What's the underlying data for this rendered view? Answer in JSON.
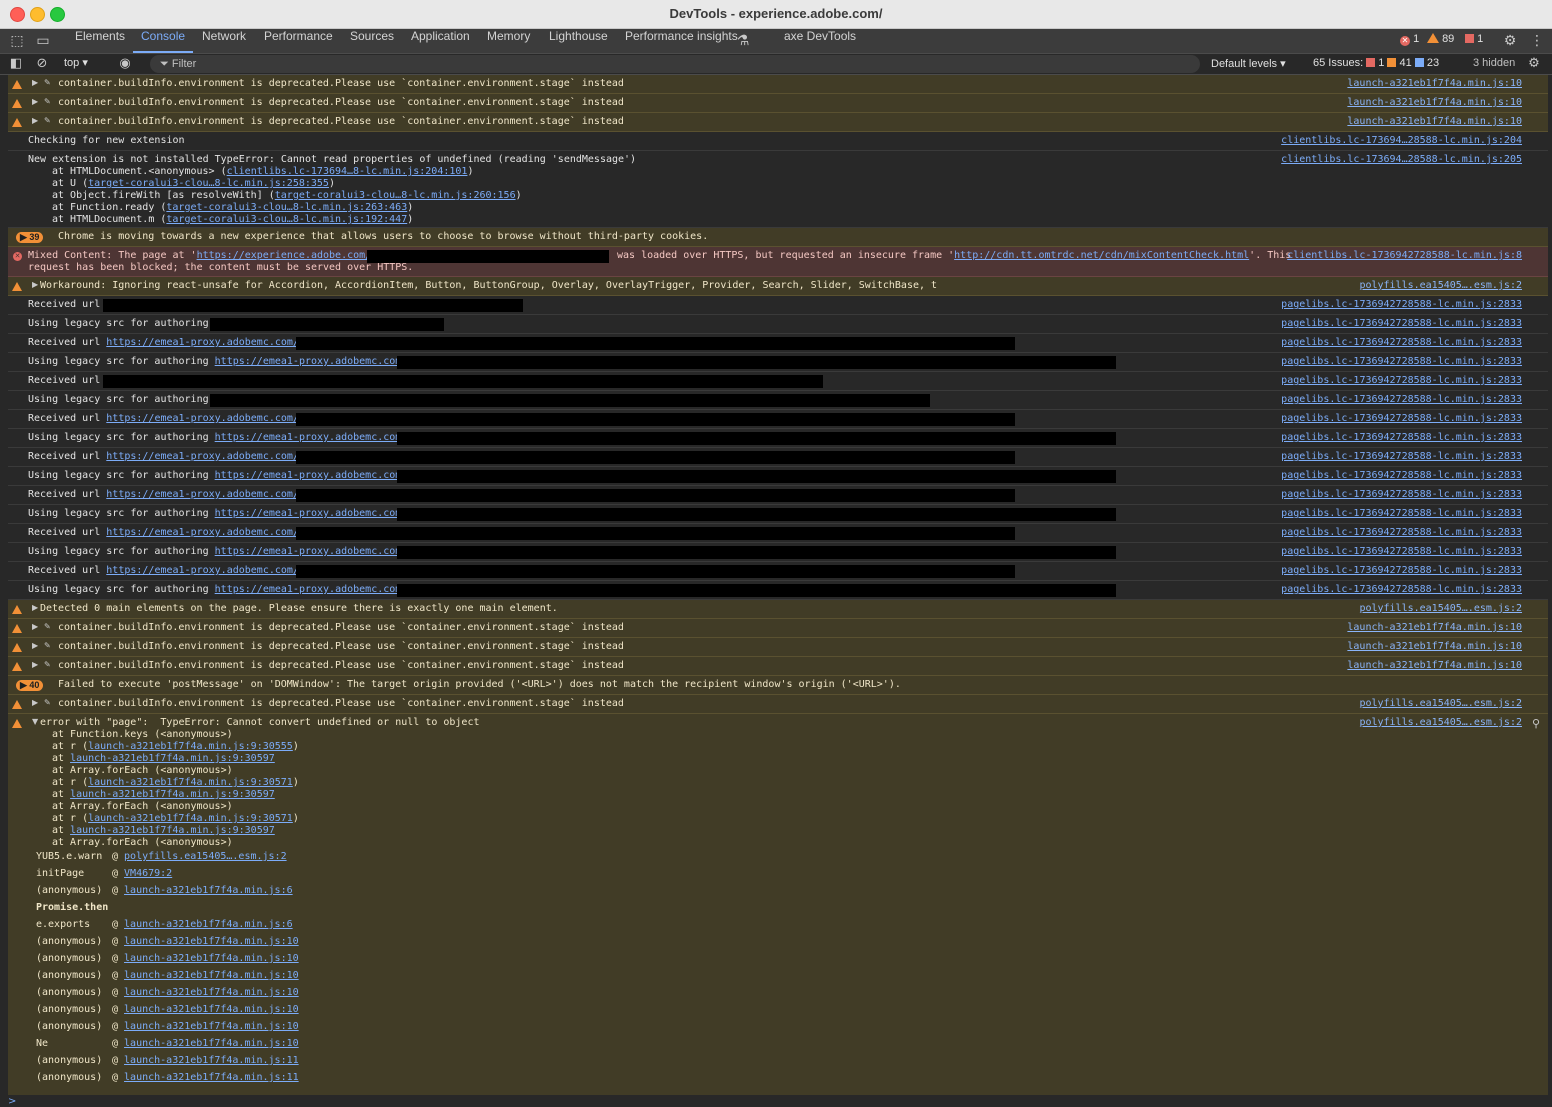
{
  "window": {
    "title": "DevTools - experience.adobe.com/"
  },
  "tabs": [
    "Elements",
    "Console",
    "Network",
    "Performance",
    "Sources",
    "Application",
    "Memory",
    "Lighthouse",
    "Performance insights",
    "axe DevTools"
  ],
  "tabbar_counts": {
    "errors": "1",
    "warnings": "89",
    "issues": "1"
  },
  "toolbar": {
    "context": "top",
    "filter_placeholder": "Filter",
    "levels": "Default levels",
    "issues_label": "65 Issues:",
    "issues_errors": "1",
    "issues_warnings": "41",
    "issues_info": "23",
    "hidden": "3 hidden"
  },
  "colors": {
    "accent": "#7cacf8",
    "warning_bg": "#413c26",
    "error_bg": "#4e3534",
    "warning_icon": "#f29037",
    "error_icon": "#e46962"
  },
  "rows": {
    "dep1": {
      "msg": "container.buildInfo.environment is deprecated.Please use `container.environment.stage` instead",
      "src": "launch-a321eb1f7f4a.min.js:10"
    },
    "dep2": {
      "msg": "container.buildInfo.environment is deprecated.Please use `container.environment.stage` instead",
      "src": "launch-a321eb1f7f4a.min.js:10"
    },
    "dep3": {
      "msg": "container.buildInfo.environment is deprecated.Please use `container.environment.stage` instead",
      "src": "launch-a321eb1f7f4a.min.js:10"
    },
    "check": {
      "msg": "Checking for new extension",
      "src": "clientlibs.lc-173694…28588-lc.min.js:204"
    },
    "newext": {
      "msg": "New extension is not installed TypeError: Cannot read properties of undefined (reading 'sendMessage')",
      "src": "clientlibs.lc-173694…28588-lc.min.js:205",
      "l1a": "at HTMLDocument.<anonymous> (",
      "l1b": "clientlibs.lc-173694…8-lc.min.js:204:101",
      "l1c": ")",
      "l2a": "at U (",
      "l2b": "target-coralui3-clou…8-lc.min.js:258:355",
      "l2c": ")",
      "l3a": "at Object.fireWith [as resolveWith] (",
      "l3b": "target-coralui3-clou…8-lc.min.js:260:156",
      "l3c": ")",
      "l4a": "at Function.ready (",
      "l4b": "target-coralui3-clou…8-lc.min.js:263:463",
      "l4c": ")",
      "l5a": "at HTMLDocument.m (",
      "l5b": "target-coralui3-clou…8-lc.min.js:192:447",
      "l5c": ")"
    },
    "chrome": {
      "count": "39",
      "msg": "Chrome is moving towards a new experience that allows users to choose to browse without third-party cookies."
    },
    "mixed": {
      "a": "Mixed Content: The page at '",
      "b": "https://experience.adobe.com/",
      "c": "was loaded over HTTPS, but requested an insecure frame '",
      "d": "http://cdn.tt.omtrdc.net/cdn/mixContentCheck.html",
      "e": "'. This",
      "line2": "request has been blocked; the content must be served over HTTPS.",
      "src": "clientlibs.lc-1736942728588-lc.min.js:8"
    },
    "workaround": {
      "msg": "Workaround: Ignoring react-unsafe for Accordion, AccordionItem, Button, ButtonGroup, Overlay, OverlayTrigger, Provider, Search, Slider, SwitchBase, t",
      "src": "polyfills.ea15405….esm.js:2"
    },
    "url_rows": [
      {
        "label": "Received url",
        "link": "",
        "src": "pagelibs.lc-1736942728588-lc.min.js:2833"
      },
      {
        "label": "Using legacy src for authoring",
        "link": "",
        "src": "pagelibs.lc-1736942728588-lc.min.js:2833"
      },
      {
        "label": "Received url",
        "link": "https://emea1-proxy.adobemc.com/",
        "src": "pagelibs.lc-1736942728588-lc.min.js:2833"
      },
      {
        "label": "Using legacy src for authoring",
        "link": "https://emea1-proxy.adobemc.com",
        "src": "pagelibs.lc-1736942728588-lc.min.js:2833"
      },
      {
        "label": "Received url",
        "link": "",
        "src": "pagelibs.lc-1736942728588-lc.min.js:2833"
      },
      {
        "label": "Using legacy src for authoring",
        "link": "",
        "src": "pagelibs.lc-1736942728588-lc.min.js:2833"
      },
      {
        "label": "Received url",
        "link": "https://emea1-proxy.adobemc.com/",
        "src": "pagelibs.lc-1736942728588-lc.min.js:2833"
      },
      {
        "label": "Using legacy src for authoring",
        "link": "https://emea1-proxy.adobemc.com",
        "src": "pagelibs.lc-1736942728588-lc.min.js:2833"
      },
      {
        "label": "Received url",
        "link": "https://emea1-proxy.adobemc.com/",
        "src": "pagelibs.lc-1736942728588-lc.min.js:2833"
      },
      {
        "label": "Using legacy src for authoring",
        "link": "https://emea1-proxy.adobemc.com",
        "src": "pagelibs.lc-1736942728588-lc.min.js:2833"
      },
      {
        "label": "Received url",
        "link": "https://emea1-proxy.adobemc.com/",
        "src": "pagelibs.lc-1736942728588-lc.min.js:2833"
      },
      {
        "label": "Using legacy src for authoring",
        "link": "https://emea1-proxy.adobemc.com",
        "src": "pagelibs.lc-1736942728588-lc.min.js:2833"
      },
      {
        "label": "Received url",
        "link": "https://emea1-proxy.adobemc.com/",
        "src": "pagelibs.lc-1736942728588-lc.min.js:2833"
      },
      {
        "label": "Using legacy src for authoring",
        "link": "https://emea1-proxy.adobemc.com",
        "src": "pagelibs.lc-1736942728588-lc.min.js:2833"
      },
      {
        "label": "Received url",
        "link": "https://emea1-proxy.adobemc.com/",
        "src": "pagelibs.lc-1736942728588-lc.min.js:2833"
      },
      {
        "label": "Using legacy src for authoring",
        "link": "https://emea1-proxy.adobemc.com",
        "src": "pagelibs.lc-1736942728588-lc.min.js:2833"
      }
    ],
    "detected": {
      "msg": "Detected 0 main elements on the page. Please ensure there is exactly one main element.",
      "src": "polyfills.ea15405….esm.js:2"
    },
    "dep4": {
      "msg": "container.buildInfo.environment is deprecated.Please use `container.environment.stage` instead",
      "src": "launch-a321eb1f7f4a.min.js:10"
    },
    "dep5": {
      "msg": "container.buildInfo.environment is deprecated.Please use `container.environment.stage` instead",
      "src": "launch-a321eb1f7f4a.min.js:10"
    },
    "dep6": {
      "msg": "container.buildInfo.environment is deprecated.Please use `container.environment.stage` instead",
      "src": "launch-a321eb1f7f4a.min.js:10"
    },
    "postmsg": {
      "count": "40",
      "msg": "Failed to execute 'postMessage' on 'DOMWindow': The target origin provided ('<URL>') does not match the recipient window's origin ('<URL>')."
    },
    "dep7": {
      "msg": "container.buildInfo.environment is deprecated.Please use `container.environment.stage` instead",
      "src": "polyfills.ea15405….esm.js:2"
    },
    "pageerr": {
      "msg": "error with \"page\":  TypeError: Cannot convert undefined or null to object",
      "src": "polyfills.ea15405….esm.js:2",
      "s1": "at Function.keys (<anonymous>)",
      "s2a": "at r (",
      "s2b": "launch-a321eb1f7f4a.min.js:9:30555",
      "s2c": ")",
      "s3a": "at ",
      "s3b": "launch-a321eb1f7f4a.min.js:9:30597",
      "s4": "at Array.forEach (<anonymous>)",
      "s5a": "at r (",
      "s5b": "launch-a321eb1f7f4a.min.js:9:30571",
      "s5c": ")",
      "s6a": "at ",
      "s6b": "launch-a321eb1f7f4a.min.js:9:30597",
      "s7": "at Array.forEach (<anonymous>)",
      "s8a": "at r (",
      "s8b": "launch-a321eb1f7f4a.min.js:9:30571",
      "s8c": ")",
      "s9a": "at ",
      "s9b": "launch-a321eb1f7f4a.min.js:9:30597",
      "s10": "at Array.forEach (<anonymous>)",
      "calls": [
        {
          "fn": "YUB5.e.warn",
          "at": "@",
          "src": "polyfills.ea15405….esm.js:2"
        },
        {
          "fn": "initPage",
          "at": "@",
          "src": "VM4679:2"
        },
        {
          "fn": "(anonymous)",
          "at": "@",
          "src": "launch-a321eb1f7f4a.min.js:6"
        },
        {
          "fn": "Promise.then",
          "at": "",
          "src": ""
        },
        {
          "fn": "e.exports",
          "at": "@",
          "src": "launch-a321eb1f7f4a.min.js:6"
        },
        {
          "fn": "(anonymous)",
          "at": "@",
          "src": "launch-a321eb1f7f4a.min.js:10"
        },
        {
          "fn": "(anonymous)",
          "at": "@",
          "src": "launch-a321eb1f7f4a.min.js:10"
        },
        {
          "fn": "(anonymous)",
          "at": "@",
          "src": "launch-a321eb1f7f4a.min.js:10"
        },
        {
          "fn": "(anonymous)",
          "at": "@",
          "src": "launch-a321eb1f7f4a.min.js:10"
        },
        {
          "fn": "(anonymous)",
          "at": "@",
          "src": "launch-a321eb1f7f4a.min.js:10"
        },
        {
          "fn": "(anonymous)",
          "at": "@",
          "src": "launch-a321eb1f7f4a.min.js:10"
        },
        {
          "fn": "Ne",
          "at": "@",
          "src": "launch-a321eb1f7f4a.min.js:10"
        },
        {
          "fn": "(anonymous)",
          "at": "@",
          "src": "launch-a321eb1f7f4a.min.js:11"
        },
        {
          "fn": "(anonymous)",
          "at": "@",
          "src": "launch-a321eb1f7f4a.min.js:11"
        }
      ]
    }
  },
  "prompt": ">"
}
